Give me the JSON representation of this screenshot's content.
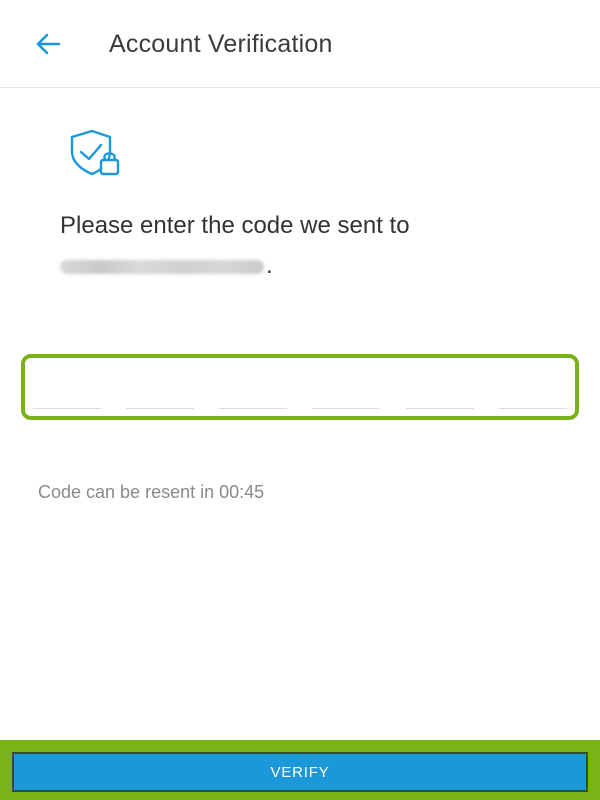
{
  "header": {
    "title": "Account Verification",
    "back_icon": "arrow-left-icon"
  },
  "main": {
    "shield_icon": "shield-check-lock-icon",
    "prompt_text": "Please enter the code we sent to",
    "email_masked_suffix": ".",
    "code_digits": [
      "",
      "",
      "",
      "",
      "",
      ""
    ],
    "resend_text": "Code can be resent in 00:45"
  },
  "footer": {
    "verify_label": "VERIFY"
  },
  "colors": {
    "accent_blue": "#1a98d8",
    "highlight_green": "#7ab317",
    "text_dark": "#333333",
    "text_muted": "#8a8a8a"
  }
}
